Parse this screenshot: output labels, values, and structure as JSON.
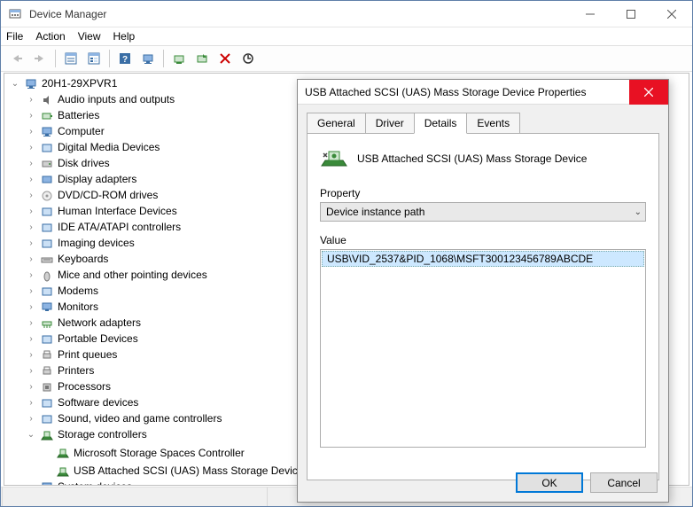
{
  "window": {
    "title": "Device Manager",
    "menus": [
      "File",
      "Action",
      "View",
      "Help"
    ]
  },
  "tree": {
    "root": "20H1-29XPVR1",
    "categories": [
      "Audio inputs and outputs",
      "Batteries",
      "Computer",
      "Digital Media Devices",
      "Disk drives",
      "Display adapters",
      "DVD/CD-ROM drives",
      "Human Interface Devices",
      "IDE ATA/ATAPI controllers",
      "Imaging devices",
      "Keyboards",
      "Mice and other pointing devices",
      "Modems",
      "Monitors",
      "Network adapters",
      "Portable Devices",
      "Print queues",
      "Printers",
      "Processors",
      "Software devices",
      "Sound, video and game controllers",
      "Storage controllers",
      "System devices"
    ],
    "storage_children": [
      "Microsoft Storage Spaces Controller",
      "USB Attached SCSI (UAS) Mass Storage Device"
    ]
  },
  "dialog": {
    "title": "USB Attached SCSI (UAS) Mass Storage Device Properties",
    "tabs": [
      "General",
      "Driver",
      "Details",
      "Events"
    ],
    "active_tab": "Details",
    "device_name": "USB Attached SCSI (UAS) Mass Storage Device",
    "property_label": "Property",
    "property_selected": "Device instance path",
    "value_label": "Value",
    "value_item": "USB\\VID_2537&PID_1068\\MSFT300123456789ABCDE",
    "ok": "OK",
    "cancel": "Cancel"
  }
}
